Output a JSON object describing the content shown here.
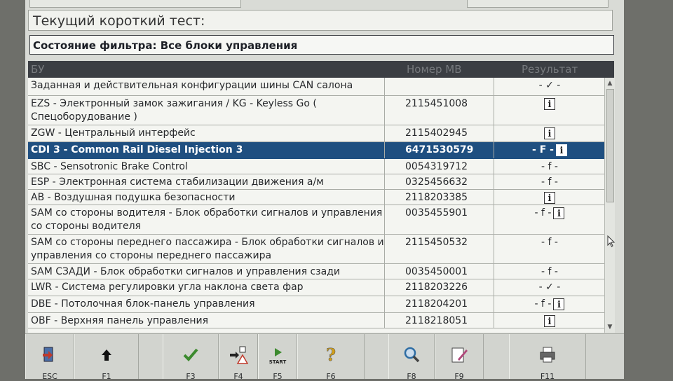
{
  "current_test": {
    "label": "Текущий короткий тест:"
  },
  "filter_status": {
    "label": "Состояние фильтра: Все блоки управления"
  },
  "table": {
    "headers": {
      "unit": "БУ",
      "number": "Номер MB",
      "result": "Результат"
    },
    "rows": [
      {
        "name": "Заданная и действительная конфигурации шины CAN салона",
        "number": "",
        "result": "- ✓ -",
        "info": false
      },
      {
        "name": "EZS - Электронный замок зажигания / KG - Keyless Go ( Спецоборудование )",
        "number": "2115451008",
        "result": "",
        "info": true
      },
      {
        "name": "ZGW - Центральный интерфейс",
        "number": "2115402945",
        "result": "",
        "info": true
      },
      {
        "name": "CDI 3 - Common Rail Diesel Injection 3",
        "number": "6471530579",
        "result": "- F -",
        "info": true
      },
      {
        "name": "SBC - Sensotronic Brake Control",
        "number": "0054319712",
        "result": "- f -",
        "info": false
      },
      {
        "name": "ESP - Электронная система стабилизации движения а/м",
        "number": "0325456632",
        "result": "- f -",
        "info": false
      },
      {
        "name": "AB - Воздушная подушка безопасности",
        "number": "2118203385",
        "result": "",
        "info": true
      },
      {
        "name": "SAM со стороны водителя - Блок обработки сигналов и управления со стороны водителя",
        "number": "0035455901",
        "result": "- f -",
        "info": true
      },
      {
        "name": "SAM со стороны переднего пассажира - Блок обработки сигналов и управления со стороны переднего пассажира",
        "number": "2115450532",
        "result": "- f -",
        "info": false
      },
      {
        "name": "SAM СЗАДИ - Блок обработки сигналов и управления сзади",
        "number": "0035450001",
        "result": "- f -",
        "info": false
      },
      {
        "name": "LWR - Система регулировки угла наклона света фар",
        "number": "2118203226",
        "result": "- ✓ -",
        "info": false
      },
      {
        "name": "DBE - Потолочная блок-панель управления",
        "number": "2118204201",
        "result": "- f -",
        "info": true
      },
      {
        "name": "OBF - Верхняя панель управления",
        "number": "2118218051",
        "result": "",
        "info": true
      }
    ],
    "selected_index": 3
  },
  "info_glyph": "i",
  "toolbar": {
    "buttons": [
      {
        "id": "esc",
        "label": "ESC",
        "icon": "exit-door-icon",
        "color": "#c0392b"
      },
      {
        "id": "f1",
        "label": "F1",
        "icon": "arrow-up-icon",
        "color": "#111111"
      },
      {
        "id": "f3",
        "label": "F3",
        "icon": "checkmark-icon",
        "color": "#3c8a2e"
      },
      {
        "id": "f4",
        "label": "F4",
        "icon": "warning-transfer-icon",
        "color": "#c0392b"
      },
      {
        "id": "f5",
        "label": "F5",
        "icon": "start-play-icon",
        "text": "START",
        "color": "#3c8a2e"
      },
      {
        "id": "f6",
        "label": "F6",
        "icon": "help-question-icon",
        "color": "#d4a017"
      },
      {
        "id": "f8",
        "label": "F8",
        "icon": "magnifier-icon",
        "color": "#2e6da4"
      },
      {
        "id": "f9",
        "label": "F9",
        "icon": "edit-document-icon",
        "color": "#b0487a"
      },
      {
        "id": "f11",
        "label": "F11",
        "icon": "printer-icon",
        "color": "#666666"
      }
    ]
  }
}
